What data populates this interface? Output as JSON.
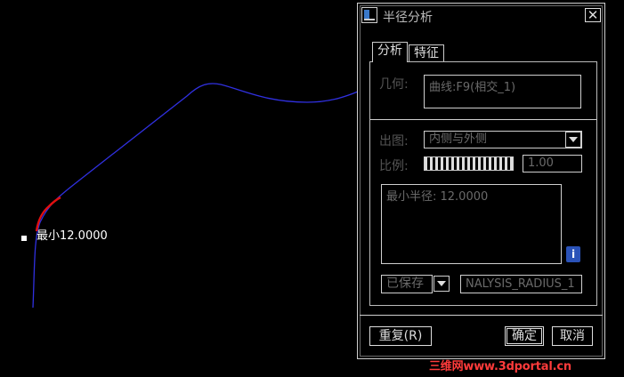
{
  "viewport": {
    "annotation": "最小12.0000",
    "curve_color": "#3030e0",
    "highlight_color": "#e01010"
  },
  "dialog": {
    "title": "半径分析",
    "close_glyph": "✕",
    "tabs": [
      {
        "label": "分析",
        "active": true
      },
      {
        "label": "特征",
        "active": false
      }
    ],
    "geometry": {
      "label": "几何:",
      "value": "曲线:F9(相交_1)"
    },
    "output": {
      "label": "出图:",
      "value": "内侧与外侧"
    },
    "scale": {
      "label": "比例:",
      "value": "1.00"
    },
    "result_text": "最小半径: 12.0000",
    "info_icon": "info-icon",
    "save": {
      "value": "已保存",
      "name_value": "NALYSIS_RADIUS_1"
    },
    "buttons": {
      "repeat": "重复(R)",
      "ok": "确定",
      "cancel": "取消"
    }
  },
  "watermark": "三维网www.3dportal.cn"
}
